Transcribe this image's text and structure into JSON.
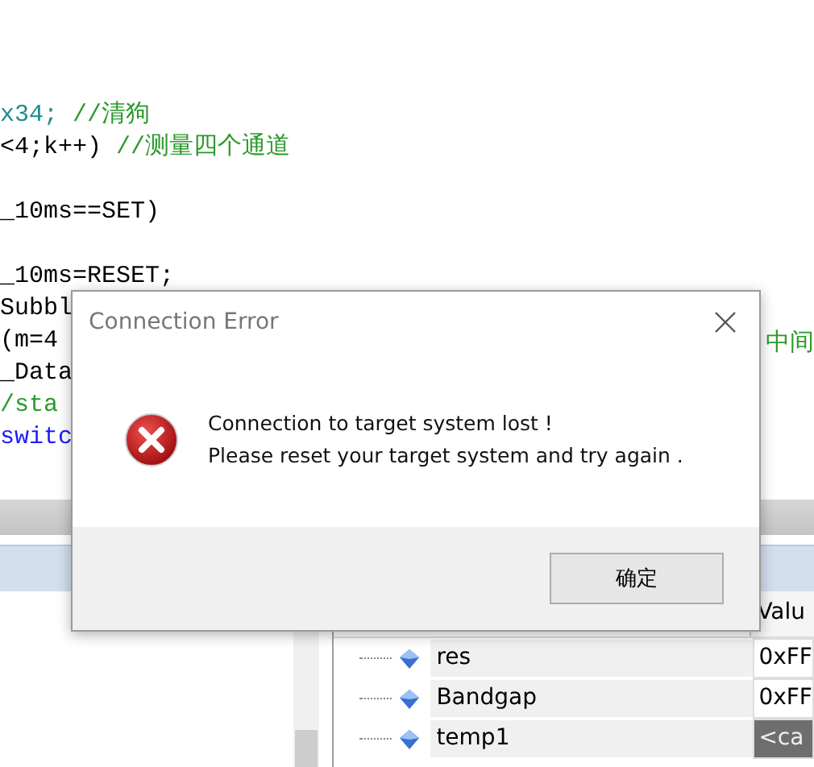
{
  "editor": {
    "lines": [
      {
        "kind": "blank"
      },
      {
        "kind": "blank"
      },
      {
        "kind": "blank"
      },
      {
        "tokens": [
          {
            "text": "x34;",
            "kind": "number"
          },
          {
            "text": " //清狗",
            "kind": "comment"
          }
        ]
      },
      {
        "tokens": [
          {
            "text": "<4;k++)",
            "kind": "code"
          },
          {
            "text": " //测量四个通道",
            "kind": "comment"
          }
        ]
      },
      {
        "kind": "blank"
      },
      {
        "tokens": [
          {
            "text": "_10ms==SET)",
            "kind": "code"
          }
        ]
      },
      {
        "kind": "blank"
      },
      {
        "tokens": [
          {
            "text": "_10ms=RESET;",
            "kind": "code"
          }
        ]
      },
      {
        "tokens": [
          {
            "text": "Subbl",
            "kind": "code"
          }
        ]
      },
      {
        "tokens": [
          {
            "text": "(m=4",
            "kind": "code"
          }
        ],
        "trailing": "中间"
      },
      {
        "tokens": [
          {
            "text": "_Data",
            "kind": "code"
          }
        ]
      },
      {
        "tokens": [
          {
            "text": "/sta",
            "kind": "comment"
          }
        ]
      },
      {
        "tokens": [
          {
            "text": "switc",
            "kind": "keyword"
          }
        ]
      }
    ]
  },
  "watch": {
    "columns": [
      "Valu"
    ],
    "rows": [
      {
        "name": "res",
        "value": "0xFF",
        "selected": false
      },
      {
        "name": "Bandgap",
        "value": "0xFF",
        "selected": false
      },
      {
        "name": "temp1",
        "value": "<ca",
        "selected": true
      }
    ]
  },
  "dialog": {
    "title": "Connection Error",
    "message_lines": [
      "Connection to target system lost !",
      "Please reset your target system and try again ."
    ],
    "button": "确定"
  }
}
